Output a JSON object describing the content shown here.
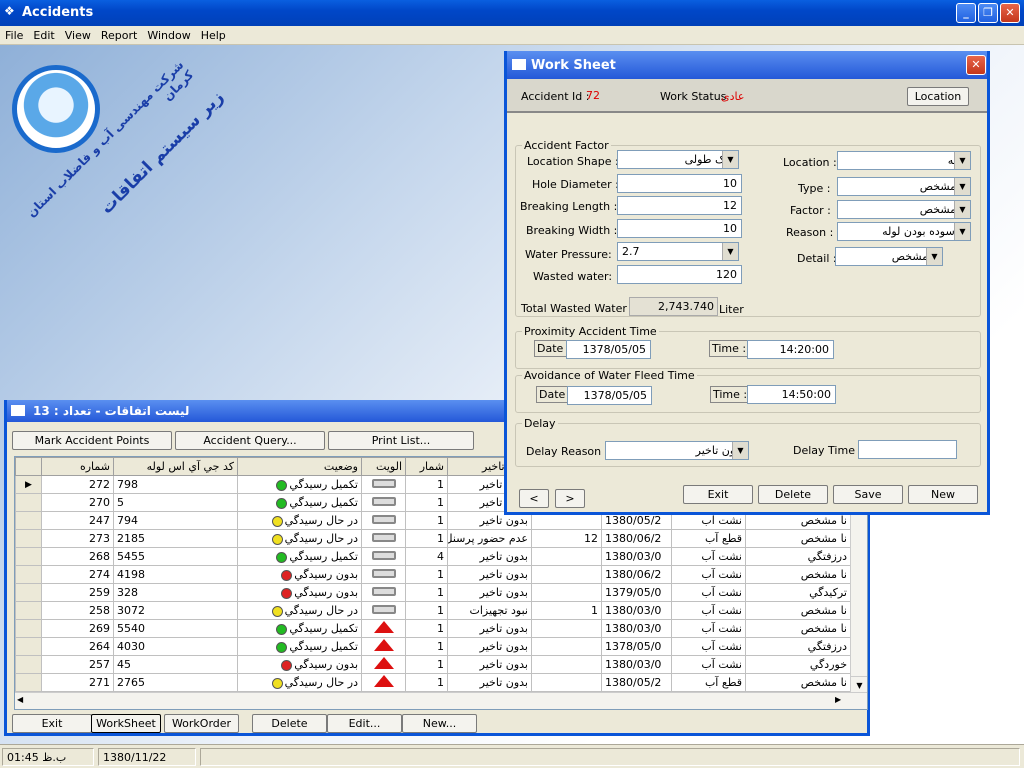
{
  "app": {
    "title": "Accidents"
  },
  "menu": [
    "File",
    "Edit",
    "View",
    "Report",
    "Window",
    "Help"
  ],
  "logo": {
    "line1": "شرکت مهندسی آب و فاضلاب استان کرمان",
    "line2": "زیر سیستم اتفاقات"
  },
  "list_window": {
    "title": "لیست اتفاقات - تعداد : 13",
    "toolbar": {
      "mark": "Mark Accident Points",
      "query": "Accident Query...",
      "print": "Print List..."
    },
    "columns": [
      "شماره",
      "كد جي آي اس لوله",
      "وضعيت",
      "الويت",
      "شمار",
      "دليل تاخير",
      "",
      "",
      "",
      ""
    ],
    "rows": [
      {
        "num": "272",
        "gis": "798",
        "status": "تكميل رسيدگي",
        "color": "#22bb22",
        "pri": "low",
        "cnt": "1",
        "delay": "بدون تاخير",
        "qty": "",
        "date": "",
        "type": "",
        "reason": ""
      },
      {
        "num": "270",
        "gis": "5",
        "status": "تكميل رسيدگي",
        "color": "#22bb22",
        "pri": "low",
        "cnt": "1",
        "delay": "بدون تاخير",
        "qty": "",
        "date": "",
        "type": "",
        "reason": ""
      },
      {
        "num": "247",
        "gis": "794",
        "status": "در حال رسيدگي",
        "color": "#f0e020",
        "pri": "low",
        "cnt": "1",
        "delay": "بدون تاخير",
        "qty": "",
        "date": "1380/05/2",
        "type": "نشت آب",
        "reason": "نا مشخص"
      },
      {
        "num": "273",
        "gis": "2185",
        "status": "در حال رسيدگي",
        "color": "#f0e020",
        "pri": "low",
        "cnt": "1",
        "delay": "عدم حضور پرسنل",
        "qty": "12",
        "date": "1380/06/2",
        "type": "قطع آب",
        "reason": "نا مشخص"
      },
      {
        "num": "268",
        "gis": "5455",
        "status": "تكميل رسيدگي",
        "color": "#22bb22",
        "pri": "low",
        "cnt": "4",
        "delay": "بدون تاخير",
        "qty": "",
        "date": "1380/03/0",
        "type": "نشت آب",
        "reason": "درزفتگي"
      },
      {
        "num": "274",
        "gis": "4198",
        "status": "بدون رسيدگي",
        "color": "#dd2222",
        "pri": "low",
        "cnt": "1",
        "delay": "بدون تاخير",
        "qty": "",
        "date": "1380/06/2",
        "type": "نشت آب",
        "reason": "نا مشخص"
      },
      {
        "num": "259",
        "gis": "328",
        "status": "بدون رسيدگي",
        "color": "#dd2222",
        "pri": "low",
        "cnt": "1",
        "delay": "بدون تاخير",
        "qty": "",
        "date": "1379/05/0",
        "type": "نشت آب",
        "reason": "تركيدگي"
      },
      {
        "num": "258",
        "gis": "3072",
        "status": "در حال رسيدگي",
        "color": "#f0e020",
        "pri": "low",
        "cnt": "1",
        "delay": "نبود تجهيزات",
        "qty": "1",
        "date": "1380/03/0",
        "type": "نشت آب",
        "reason": "نا مشخص"
      },
      {
        "num": "269",
        "gis": "5540",
        "status": "تكميل رسيدگي",
        "color": "#22bb22",
        "pri": "high",
        "cnt": "1",
        "delay": "بدون تاخير",
        "qty": "",
        "date": "1380/03/0",
        "type": "نشت آب",
        "reason": "نا مشخص"
      },
      {
        "num": "264",
        "gis": "4030",
        "status": "تكميل رسيدگي",
        "color": "#22bb22",
        "pri": "high",
        "cnt": "1",
        "delay": "بدون تاخير",
        "qty": "",
        "date": "1378/05/0",
        "type": "نشت آب",
        "reason": "درزفتگي"
      },
      {
        "num": "257",
        "gis": "45",
        "status": "بدون رسيدگي",
        "color": "#dd2222",
        "pri": "high",
        "cnt": "1",
        "delay": "بدون تاخير",
        "qty": "",
        "date": "1380/03/0",
        "type": "نشت آب",
        "reason": "خوردگي"
      },
      {
        "num": "271",
        "gis": "2765",
        "status": "در حال رسيدگي",
        "color": "#f0e020",
        "pri": "high",
        "cnt": "1",
        "delay": "بدون تاخير",
        "qty": "",
        "date": "1380/05/2",
        "type": "قطع آب",
        "reason": "نا مشخص"
      }
    ],
    "bottom": {
      "exit": "Exit",
      "worksheet": "WorkSheet",
      "workorder": "WorkOrder",
      "delete": "Delete",
      "edit": "Edit...",
      "new": "New..."
    }
  },
  "worksheet": {
    "title": "Work Sheet",
    "accident_id_label": "Accident Id :",
    "accident_id": "72",
    "work_status_label": "Work Status",
    "work_status": "عادی",
    "location_btn": "Location",
    "factor_group": "Accident Factor",
    "location_shape_label": "Location Shape :",
    "location_shape": "ترک طولی",
    "hole_diameter_label": "Hole Diameter :",
    "hole_diameter": "10",
    "breaking_length_label": "Breaking Length :",
    "breaking_length": "12",
    "breaking_width_label": "Breaking Width :",
    "breaking_width": "10",
    "water_pressure_label": "Water Pressure:",
    "water_pressure": "2.7",
    "wasted_water_label": "Wasted water:",
    "wasted_water": "120",
    "total_wasted_label": "Total Wasted Water :",
    "total_wasted": "2,743.740",
    "total_unit": "Liter",
    "location_label": "Location :",
    "location": "لوله",
    "type_label": "Type :",
    "type": "نا مشخص",
    "factor_label": "Factor :",
    "factor": "نا مشخص",
    "reason_label": "Reason :",
    "reason": "فرسوده بودن لوله",
    "detail_label": "Detail :",
    "detail": "نا مشخص",
    "proximity_group": "Proximity Accident Time",
    "avoidance_group": "Avoidance of Water Fleed Time",
    "date_label": "Date :",
    "time_label": "Time :",
    "prox_date": "1378/05/05",
    "prox_time": "14:20:00",
    "avoid_date": "1378/05/05",
    "avoid_time": "14:50:00",
    "delay_group": "Delay",
    "delay_reason_label": "Delay Reason :",
    "delay_reason": "بدون تاخير",
    "delay_time_label": "Delay Time :",
    "delay_time": "",
    "prev": "<",
    "next": ">",
    "exit": "Exit",
    "delete": "Delete",
    "save": "Save",
    "new": "New"
  },
  "status": {
    "time": "01:45 ب.ظ",
    "date": "1380/11/22"
  }
}
